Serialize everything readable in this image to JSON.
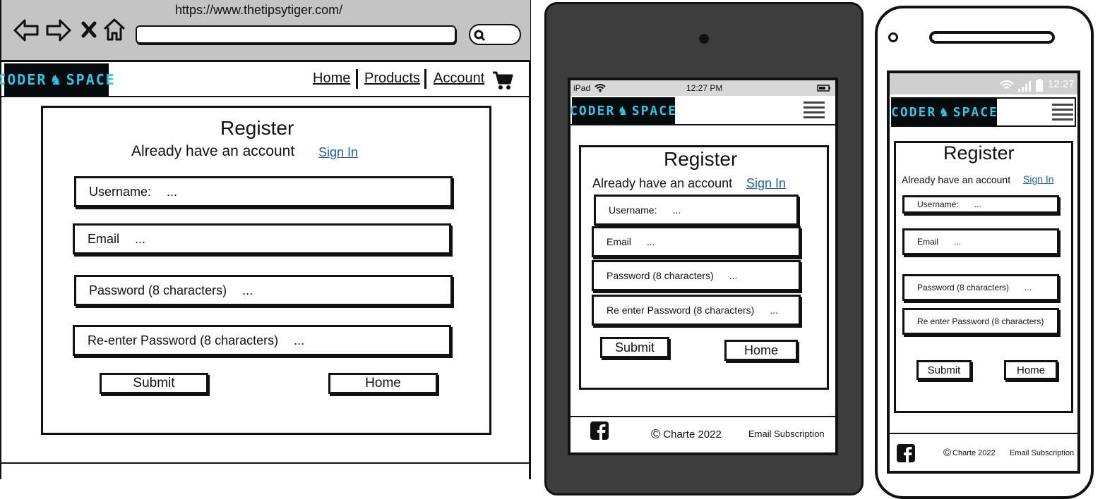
{
  "desktop": {
    "url": "https://www.thetipsytiger.com/",
    "nav": {
      "home": "Home",
      "products": "Products",
      "account": "Account"
    },
    "logo": {
      "left": "CODER",
      "right": "SPACE"
    },
    "form": {
      "title": "Register",
      "subtitle": "Already have an account",
      "signin": "Sign In",
      "fields": [
        {
          "label": "Username:",
          "value": "..."
        },
        {
          "label": "Email",
          "value": "..."
        },
        {
          "label": "Password (8 characters)",
          "value": "..."
        },
        {
          "label": "Re-enter Password (8 characters)",
          "value": "..."
        }
      ],
      "submit": "Submit",
      "home": "Home"
    }
  },
  "tablet": {
    "status": {
      "carrier": "iPad",
      "time": "12:27 PM"
    },
    "logo": {
      "left": "CODER",
      "right": "SPACE"
    },
    "form": {
      "title": "Register",
      "subtitle": "Already have an account",
      "signin": "Sign In",
      "fields": [
        {
          "label": "Username:",
          "value": "..."
        },
        {
          "label": "Email",
          "value": "..."
        },
        {
          "label": "Password (8 characters)",
          "value": "..."
        },
        {
          "label": "Re enter Password (8 characters)",
          "value": "..."
        }
      ],
      "submit": "Submit",
      "home": "Home"
    },
    "footer": {
      "copyright": "Charte 2022",
      "subscription": "Email Subscription"
    }
  },
  "phone": {
    "status": {
      "time": "12:27"
    },
    "logo": {
      "left": "CODER",
      "right": "SPACE"
    },
    "form": {
      "title": "Register",
      "subtitle": "Already have an account",
      "signin": "Sign In",
      "fields": [
        {
          "label": "Username:",
          "value": "..."
        },
        {
          "label": "Email",
          "value": "..."
        },
        {
          "label": "Password (8 characters)",
          "value": "..."
        },
        {
          "label": "Re enter Password (8 characters)",
          "value": "..."
        }
      ],
      "submit": "Submit",
      "home": "Home"
    },
    "footer": {
      "copyright": "Charte 2022",
      "subscription": "Email Subscription"
    }
  },
  "colors": {
    "browser_chrome": "#c4c4c4",
    "tablet_body": "#3d3d3d",
    "logo_bg": "#050a0c",
    "logo_text": "#2fc4e8",
    "link": "#1f5faa"
  },
  "icons": [
    "back-arrow-icon",
    "forward-arrow-icon",
    "stop-icon",
    "home-icon",
    "search-icon",
    "cart-icon",
    "wifi-icon",
    "battery-icon",
    "signal-icon",
    "hamburger-menu-icon",
    "facebook-icon",
    "copyright-icon"
  ]
}
